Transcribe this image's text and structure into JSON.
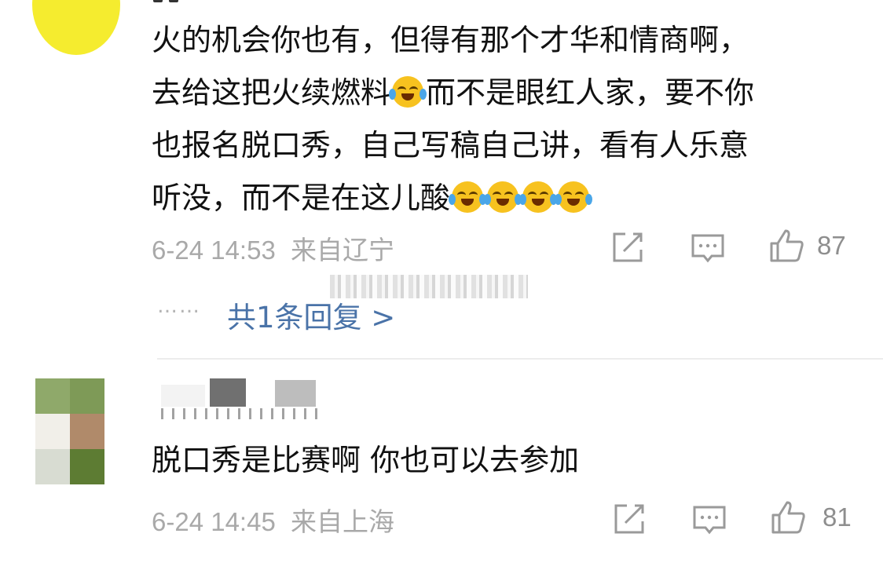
{
  "colors": {
    "avatar1": "#f5ec2f",
    "link": "#4a73a8",
    "meta_gray": "#a9a9a9",
    "emoji_face": "#f7c21f",
    "emoji_tear": "#4aa6e8"
  },
  "comments": [
    {
      "text_lines": [
        "火的机会你也有，但得有那个才华和情商啊，",
        "去给这把火续燃料",
        "而不是眼红人家，要不你",
        "也报名脱口秀，自己写稿自己讲，看有人乐意",
        "听没，而不是在这儿酸"
      ],
      "emoji_icon": "crying-laughing-emoji",
      "timestamp": "6-24 14:53",
      "location": "来自辽宁",
      "likes": "87",
      "replies_link": "共1条回复 >",
      "replies_dots": "……"
    },
    {
      "text": "脱口秀是比赛啊 你也可以去参加",
      "timestamp": "6-24 14:45",
      "location": "来自上海",
      "likes": "81"
    }
  ],
  "icons": {
    "share": "share-icon",
    "comment": "comment-icon",
    "like": "thumbs-up-icon"
  }
}
